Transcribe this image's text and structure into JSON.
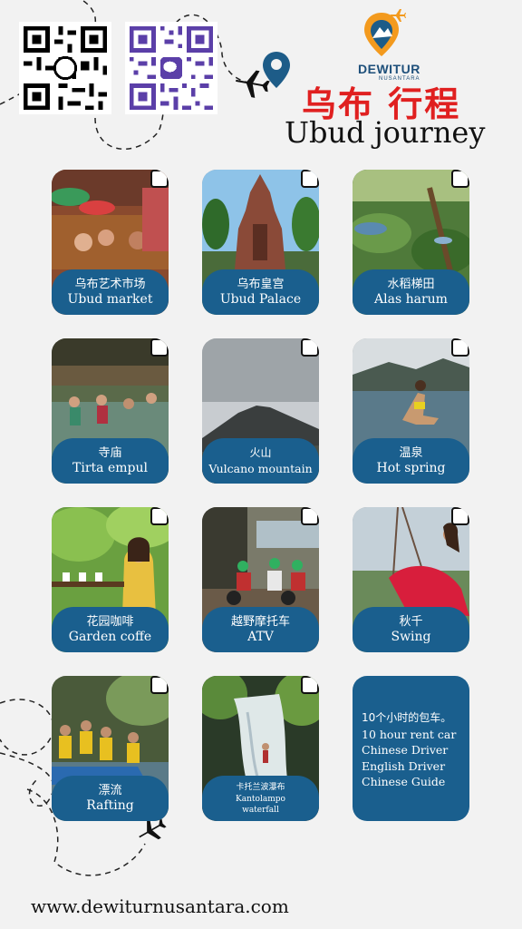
{
  "brand": {
    "name": "DEWITUR",
    "sub": "NUSANTARA"
  },
  "title": {
    "cn": "乌布 行程",
    "en": "Ubud journey"
  },
  "qr_codes": [
    {
      "icon": "whatsapp-icon",
      "color": "#000000"
    },
    {
      "icon": "wechat-icon",
      "color": "#5b3fa8"
    }
  ],
  "colors": {
    "accent": "#1a5f8e",
    "title_red": "#e02020",
    "logo_blue": "#1d4f7a",
    "logo_orange": "#f39a1e"
  },
  "destinations": [
    {
      "cn": "乌布艺术市场",
      "en": "Ubud market"
    },
    {
      "cn": "乌布皇宫",
      "en": "Ubud Palace"
    },
    {
      "cn": "水稻梯田",
      "en": "Alas harum"
    },
    {
      "cn": "寺庙",
      "en": "Tirta empul"
    },
    {
      "cn": "火山",
      "en": "Vulcano mountain"
    },
    {
      "cn": "温泉",
      "en": "Hot spring"
    },
    {
      "cn": "花园咖啡",
      "en": "Garden coffe"
    },
    {
      "cn": "越野摩托车",
      "en": "ATV"
    },
    {
      "cn": "秋千",
      "en": "Swing"
    },
    {
      "cn": "漂流",
      "en": "Rafting"
    },
    {
      "cn": "卡托兰波瀑布",
      "en": "Kantolampo waterfall"
    }
  ],
  "info": {
    "lines": [
      "10个小时的包车。",
      "10 hour rent car",
      "Chinese Driver",
      "English Driver",
      "Chinese Guide"
    ]
  },
  "footer": {
    "url": "www.dewiturnusantara.com"
  }
}
